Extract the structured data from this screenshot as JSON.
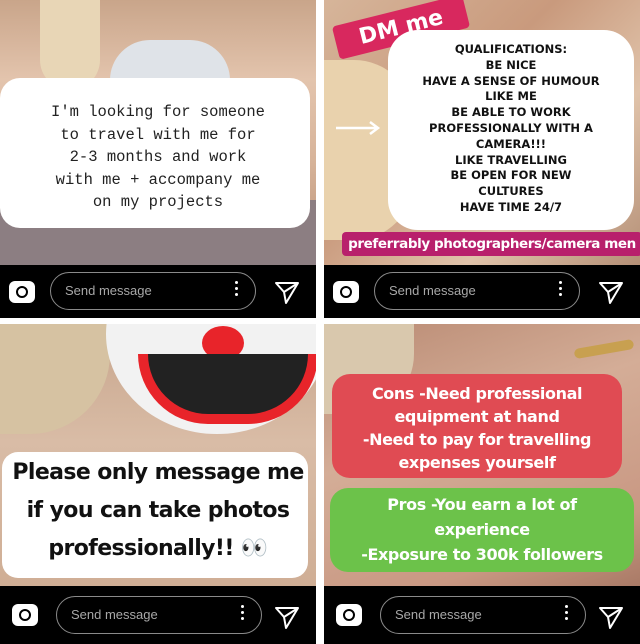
{
  "panels": [
    {
      "id": "top-left",
      "caption": "I'm looking for someone to travel with me for 2-3 months and work with me + accompany me on my projects",
      "caption_lines": [
        "I'm looking for someone",
        "to travel with me for",
        "2-3 months and work",
        "with me + accompany me",
        "on my projects"
      ],
      "bar": {
        "placeholder": "Send message"
      }
    },
    {
      "id": "top-right",
      "sticker": "DM me",
      "qualifications": [
        "QUALIFICATIONS:",
        "BE NICE",
        "HAVE A SENSE OF HUMOUR",
        "LIKE ME",
        "BE ABLE TO WORK",
        "PROFESSIONALLY WITH A",
        "CAMERA!!!",
        "LIKE TRAVELLING",
        "BE OPEN FOR NEW",
        "CULTURES",
        "HAVE TIME 24/7"
      ],
      "banner": "preferrably photographers/camera men",
      "bar": {
        "placeholder": "Send message"
      }
    },
    {
      "id": "bottom-left",
      "caption_lines": [
        "Please only message me",
        "if you can take photos",
        "professionally!! 👀"
      ],
      "bar": {
        "placeholder": "Send message"
      }
    },
    {
      "id": "bottom-right",
      "cons_lines": [
        "Cons -Need professional",
        "equipment at hand",
        "-Need to pay for travelling",
        "expenses yourself"
      ],
      "pros_lines": [
        "Pros -You earn a lot of",
        "experience",
        "-Exposure to 300k followers"
      ],
      "bar": {
        "placeholder": "Send message"
      }
    }
  ],
  "colors": {
    "pink": "#d8285e",
    "green": "#6cc24a",
    "red": "#e04b53",
    "banner": "#b8206c"
  },
  "icons": [
    "camera-icon",
    "more-options-icon",
    "send-icon"
  ]
}
